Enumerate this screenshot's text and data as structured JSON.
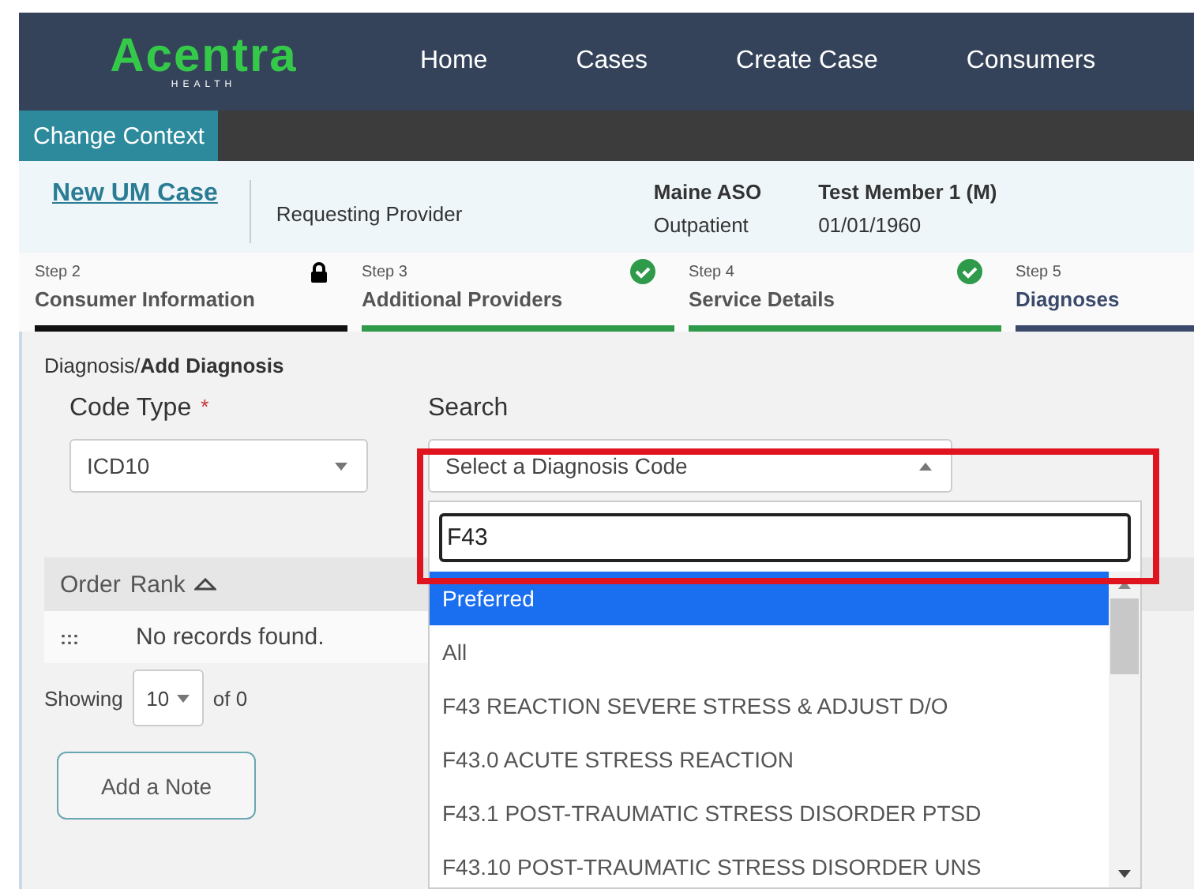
{
  "header": {
    "logo": "Acentra",
    "logo_sub": "HEALTH",
    "nav": [
      "Home",
      "Cases",
      "Create Case",
      "Consumers"
    ]
  },
  "context_bar": {
    "tab": "Change Context"
  },
  "case": {
    "link": "New UM Case",
    "provider_label": "Requesting Provider",
    "program": "Maine ASO",
    "setting": "Outpatient",
    "member": "Test Member 1 (M)",
    "dob": "01/01/1960"
  },
  "steps": [
    {
      "step": "Step 2",
      "title": "Consumer Information",
      "locked": true,
      "complete": false,
      "selected": false,
      "color": "#111111"
    },
    {
      "step": "Step 3",
      "title": "Additional Providers",
      "locked": false,
      "complete": true,
      "selected": false,
      "color": "#2e9a4a"
    },
    {
      "step": "Step 4",
      "title": "Service Details",
      "locked": false,
      "complete": true,
      "selected": false,
      "color": "#2e9a4a"
    },
    {
      "step": "Step 5",
      "title": "Diagnoses",
      "locked": false,
      "complete": false,
      "selected": true,
      "color": "#3b4a6b"
    }
  ],
  "breadcrumb": "Diagnosis/**Add Diagnosis**",
  "code_type": {
    "label": "Code Type",
    "required_mark": "*",
    "value": "ICD10"
  },
  "search": {
    "label": "Search",
    "placeholder": "Select a Diagnosis Code",
    "filter": "F43"
  },
  "options": [
    {
      "label": "Preferred",
      "selected": true
    },
    {
      "label": "All",
      "selected": false
    },
    {
      "label": "F43 REACTION SEVERE STRESS & ADJUST D/O",
      "selected": false
    },
    {
      "label": "F43.0 ACUTE STRESS REACTION",
      "selected": false
    },
    {
      "label": "F43.1 POST-TRAUMATIC STRESS DISORDER PTSD",
      "selected": false
    },
    {
      "label": "F43.10 POST-TRAUMATIC STRESS DISORDER UNS",
      "selected": false
    }
  ],
  "table": {
    "columns": [
      "Order",
      "Rank"
    ],
    "drag_handle": ":::",
    "empty": "No records found."
  },
  "paging": {
    "showing": "Showing",
    "page_size": "10",
    "of": "of 0"
  },
  "add_note": "Add a Note"
}
